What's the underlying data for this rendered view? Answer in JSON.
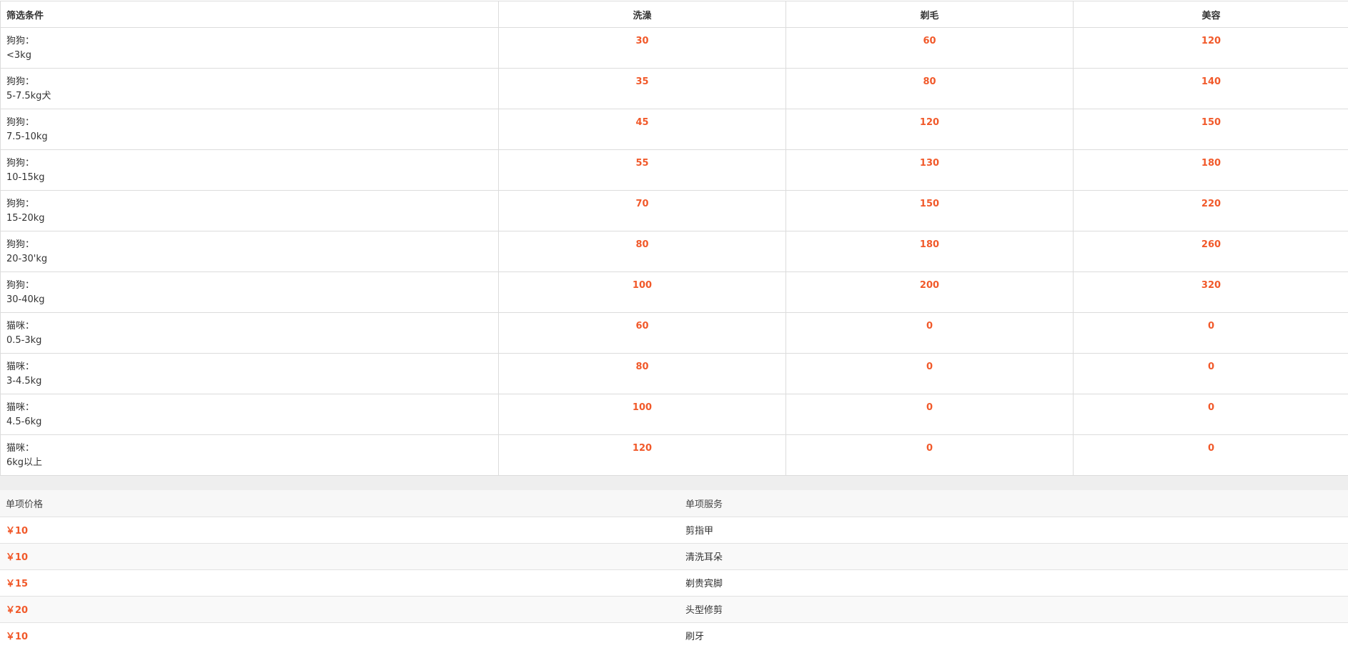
{
  "price_table": {
    "headers": [
      "筛选条件",
      "洗澡",
      "剃毛",
      "美容"
    ],
    "rows": [
      {
        "species": "狗狗：",
        "weight": "<3kg",
        "bath": "30",
        "shave": "60",
        "grooming": "120"
      },
      {
        "species": "狗狗：",
        "weight": "5-7.5kg犬",
        "bath": "35",
        "shave": "80",
        "grooming": "140"
      },
      {
        "species": "狗狗：",
        "weight": "7.5-10kg",
        "bath": "45",
        "shave": "120",
        "grooming": "150"
      },
      {
        "species": "狗狗：",
        "weight": "10-15kg",
        "bath": "55",
        "shave": "130",
        "grooming": "180"
      },
      {
        "species": "狗狗：",
        "weight": "15-20kg",
        "bath": "70",
        "shave": "150",
        "grooming": "220"
      },
      {
        "species": "狗狗：",
        "weight": "20-30'kg",
        "bath": "80",
        "shave": "180",
        "grooming": "260"
      },
      {
        "species": "狗狗：",
        "weight": "30-40kg",
        "bath": "100",
        "shave": "200",
        "grooming": "320"
      },
      {
        "species": "猫咪：",
        "weight": "0.5-3kg",
        "bath": "60",
        "shave": "0",
        "grooming": "0"
      },
      {
        "species": "猫咪：",
        "weight": "3-4.5kg",
        "bath": "80",
        "shave": "0",
        "grooming": "0"
      },
      {
        "species": "猫咪：",
        "weight": "4.5-6kg",
        "bath": "100",
        "shave": "0",
        "grooming": "0"
      },
      {
        "species": "猫咪：",
        "weight": "6kg以上",
        "bath": "120",
        "shave": "0",
        "grooming": "0"
      }
    ]
  },
  "single_items": {
    "headers": [
      "单项价格",
      "单项服务"
    ],
    "rows": [
      {
        "price": "￥10",
        "service": "剪指甲"
      },
      {
        "price": "￥10",
        "service": "清洗耳朵"
      },
      {
        "price": "￥15",
        "service": "剃贵宾脚"
      },
      {
        "price": "￥20",
        "service": "头型修剪"
      },
      {
        "price": "￥10",
        "service": "刷牙"
      }
    ]
  },
  "colors": {
    "price_accent": "#f1592a",
    "border": "#dcdcdc",
    "band": "#eeeeee"
  }
}
